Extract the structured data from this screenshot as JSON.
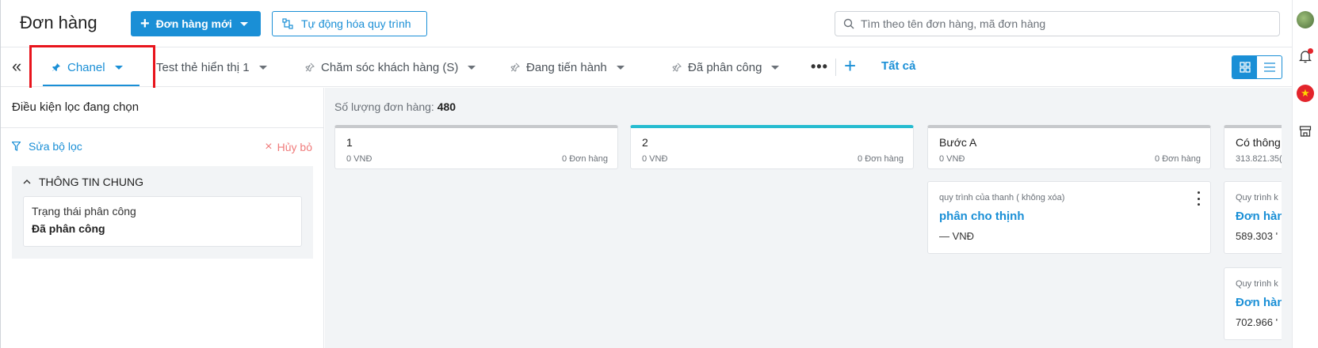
{
  "header": {
    "title": "Đơn hàng",
    "new_order_label": "Đơn hàng mới",
    "automation_label": "Tự động hóa quy trình",
    "search_placeholder": "Tìm theo tên đơn hàng, mã đơn hàng"
  },
  "tabs": {
    "items": [
      {
        "label": "Chanel",
        "pinned": true,
        "active": true
      },
      {
        "label": "Test thẻ hiển thị 1",
        "pinned": false,
        "active": false
      },
      {
        "label": "Chăm sóc khách hàng (S)",
        "pinned": true,
        "active": false
      },
      {
        "label": "Đang tiến hành",
        "pinned": true,
        "active": false
      },
      {
        "label": "Đã phân công",
        "pinned": true,
        "active": false
      }
    ],
    "more_label": "•••",
    "add_label": "+",
    "all_label": "Tất cả"
  },
  "filter": {
    "title": "Điều kiện lọc đang chọn",
    "edit_label": "Sửa bộ lọc",
    "cancel_label": "Hủy bỏ",
    "group_title": "THÔNG TIN CHUNG",
    "condition_label": "Trạng thái phân công",
    "condition_value": "Đã phân công"
  },
  "board": {
    "count_label": "Số lượng đơn hàng:",
    "count_value": "480",
    "columns": [
      {
        "name": "1",
        "amount": "0 VNĐ",
        "count": "0 Đơn hàng",
        "accent": "#c7c9cc"
      },
      {
        "name": "2",
        "amount": "0 VNĐ",
        "count": "0 Đơn hàng",
        "accent": "#26bcd0"
      },
      {
        "name": "Bước A",
        "amount": "0 VNĐ",
        "count": "0 Đơn hàng",
        "accent": "#c7c9cc"
      },
      {
        "name": "Có thông",
        "amount": "313.821.35(",
        "count": "",
        "accent": "#c7c9cc"
      }
    ],
    "cards": [
      {
        "process": "quy trình của thanh ( không xóa)",
        "name": "phân cho thịnh",
        "amount": "— VNĐ"
      },
      {
        "process": "Quy trình k",
        "name": "Đơn hàn",
        "amount": "589.303 '"
      },
      {
        "process": "Quy trình k",
        "name": "Đơn hàn",
        "amount": "702.966 '"
      }
    ]
  },
  "colors": {
    "primary": "#1a8fd6",
    "highlight": "#e8141c",
    "cancel": "#f07b7b",
    "board_bg": "#f2f4f6"
  }
}
